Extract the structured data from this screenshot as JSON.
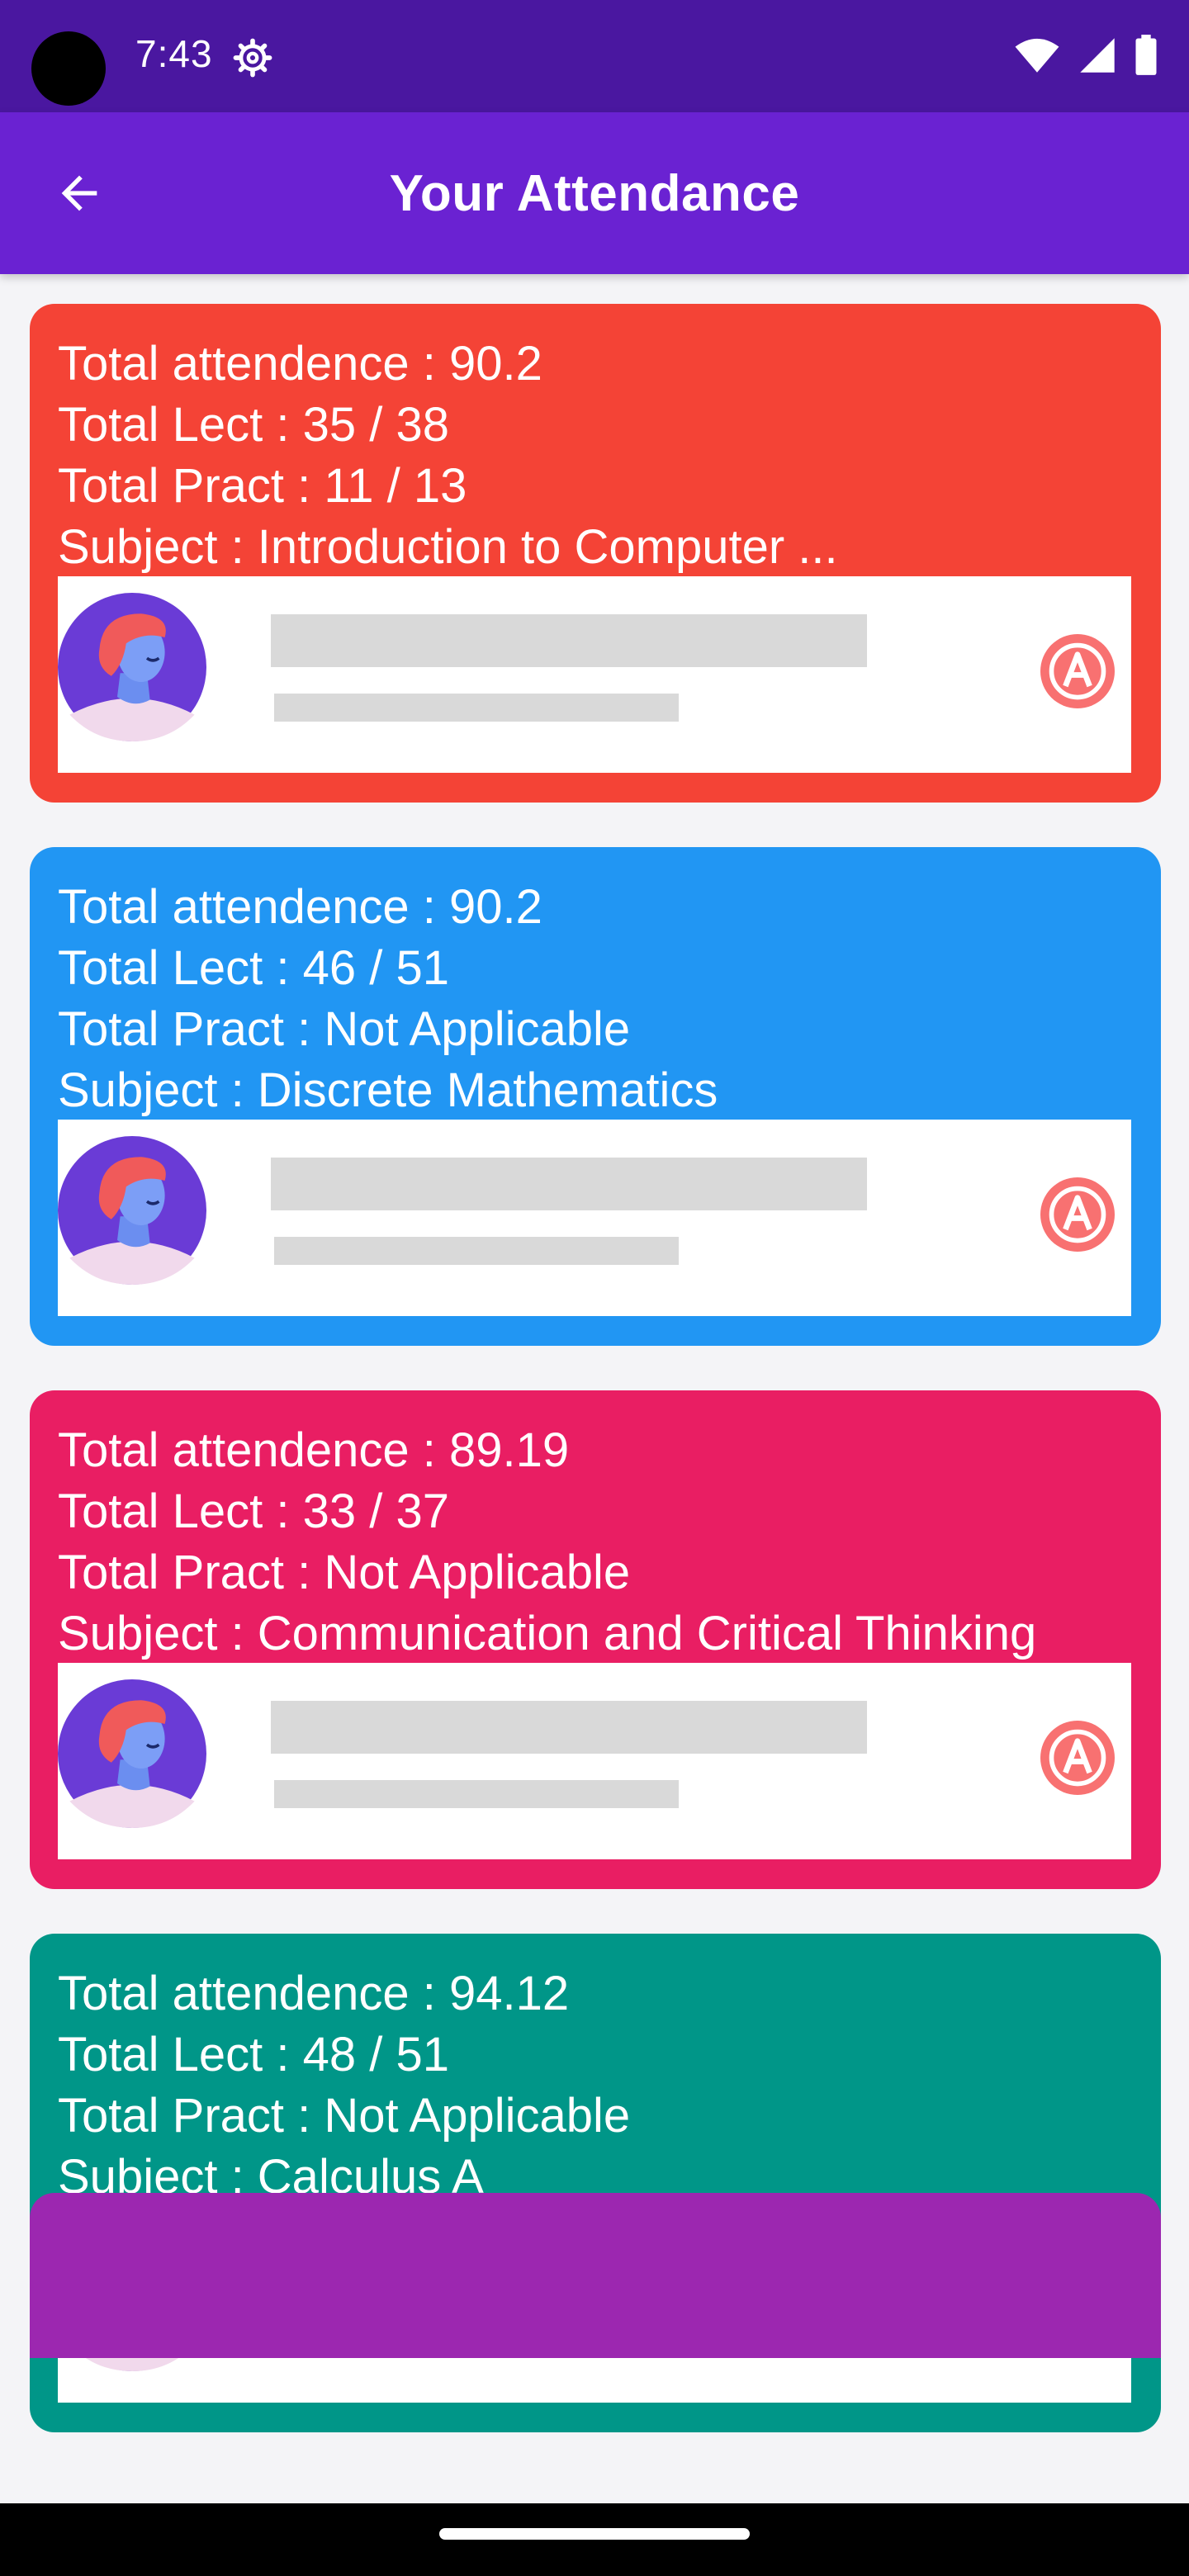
{
  "status_bar": {
    "time": "7:43",
    "icons": [
      "settings-gear-icon",
      "wifi-icon",
      "signal-icon",
      "battery-icon"
    ]
  },
  "app_bar": {
    "title": "Your Attendance",
    "back_icon": "arrow-back-icon",
    "background": "#6a22d2"
  },
  "cards": [
    {
      "color": "#f44336",
      "attendance": "Total attendence : 90.2",
      "lect": "Total Lect : 35 / 38",
      "pract": "Total Pract : 11 / 13",
      "subject": "Subject : Introduction to Computer ..."
    },
    {
      "color": "#2196f3",
      "attendance": "Total attendence : 90.2",
      "lect": "Total Lect : 46 / 51",
      "pract": "Total Pract : Not Applicable",
      "subject": "Subject : Discrete Mathematics"
    },
    {
      "color": "#e91e63",
      "attendance": "Total attendence : 89.19",
      "lect": "Total Lect : 33 / 37",
      "pract": "Total Pract : Not Applicable",
      "subject": "Subject : Communication and Critical Thinking"
    },
    {
      "color": "#009688",
      "attendance": "Total attendence : 94.12",
      "lect": "Total Lect : 48 / 51",
      "pract": "Total Pract : Not Applicable",
      "subject": "Subject : Calculus A"
    }
  ],
  "peek_card_color": "#9c27b0",
  "ad_banner": {
    "avatar_icon": "person-avatar-icon",
    "badge_icon": "ad-badge-icon"
  }
}
